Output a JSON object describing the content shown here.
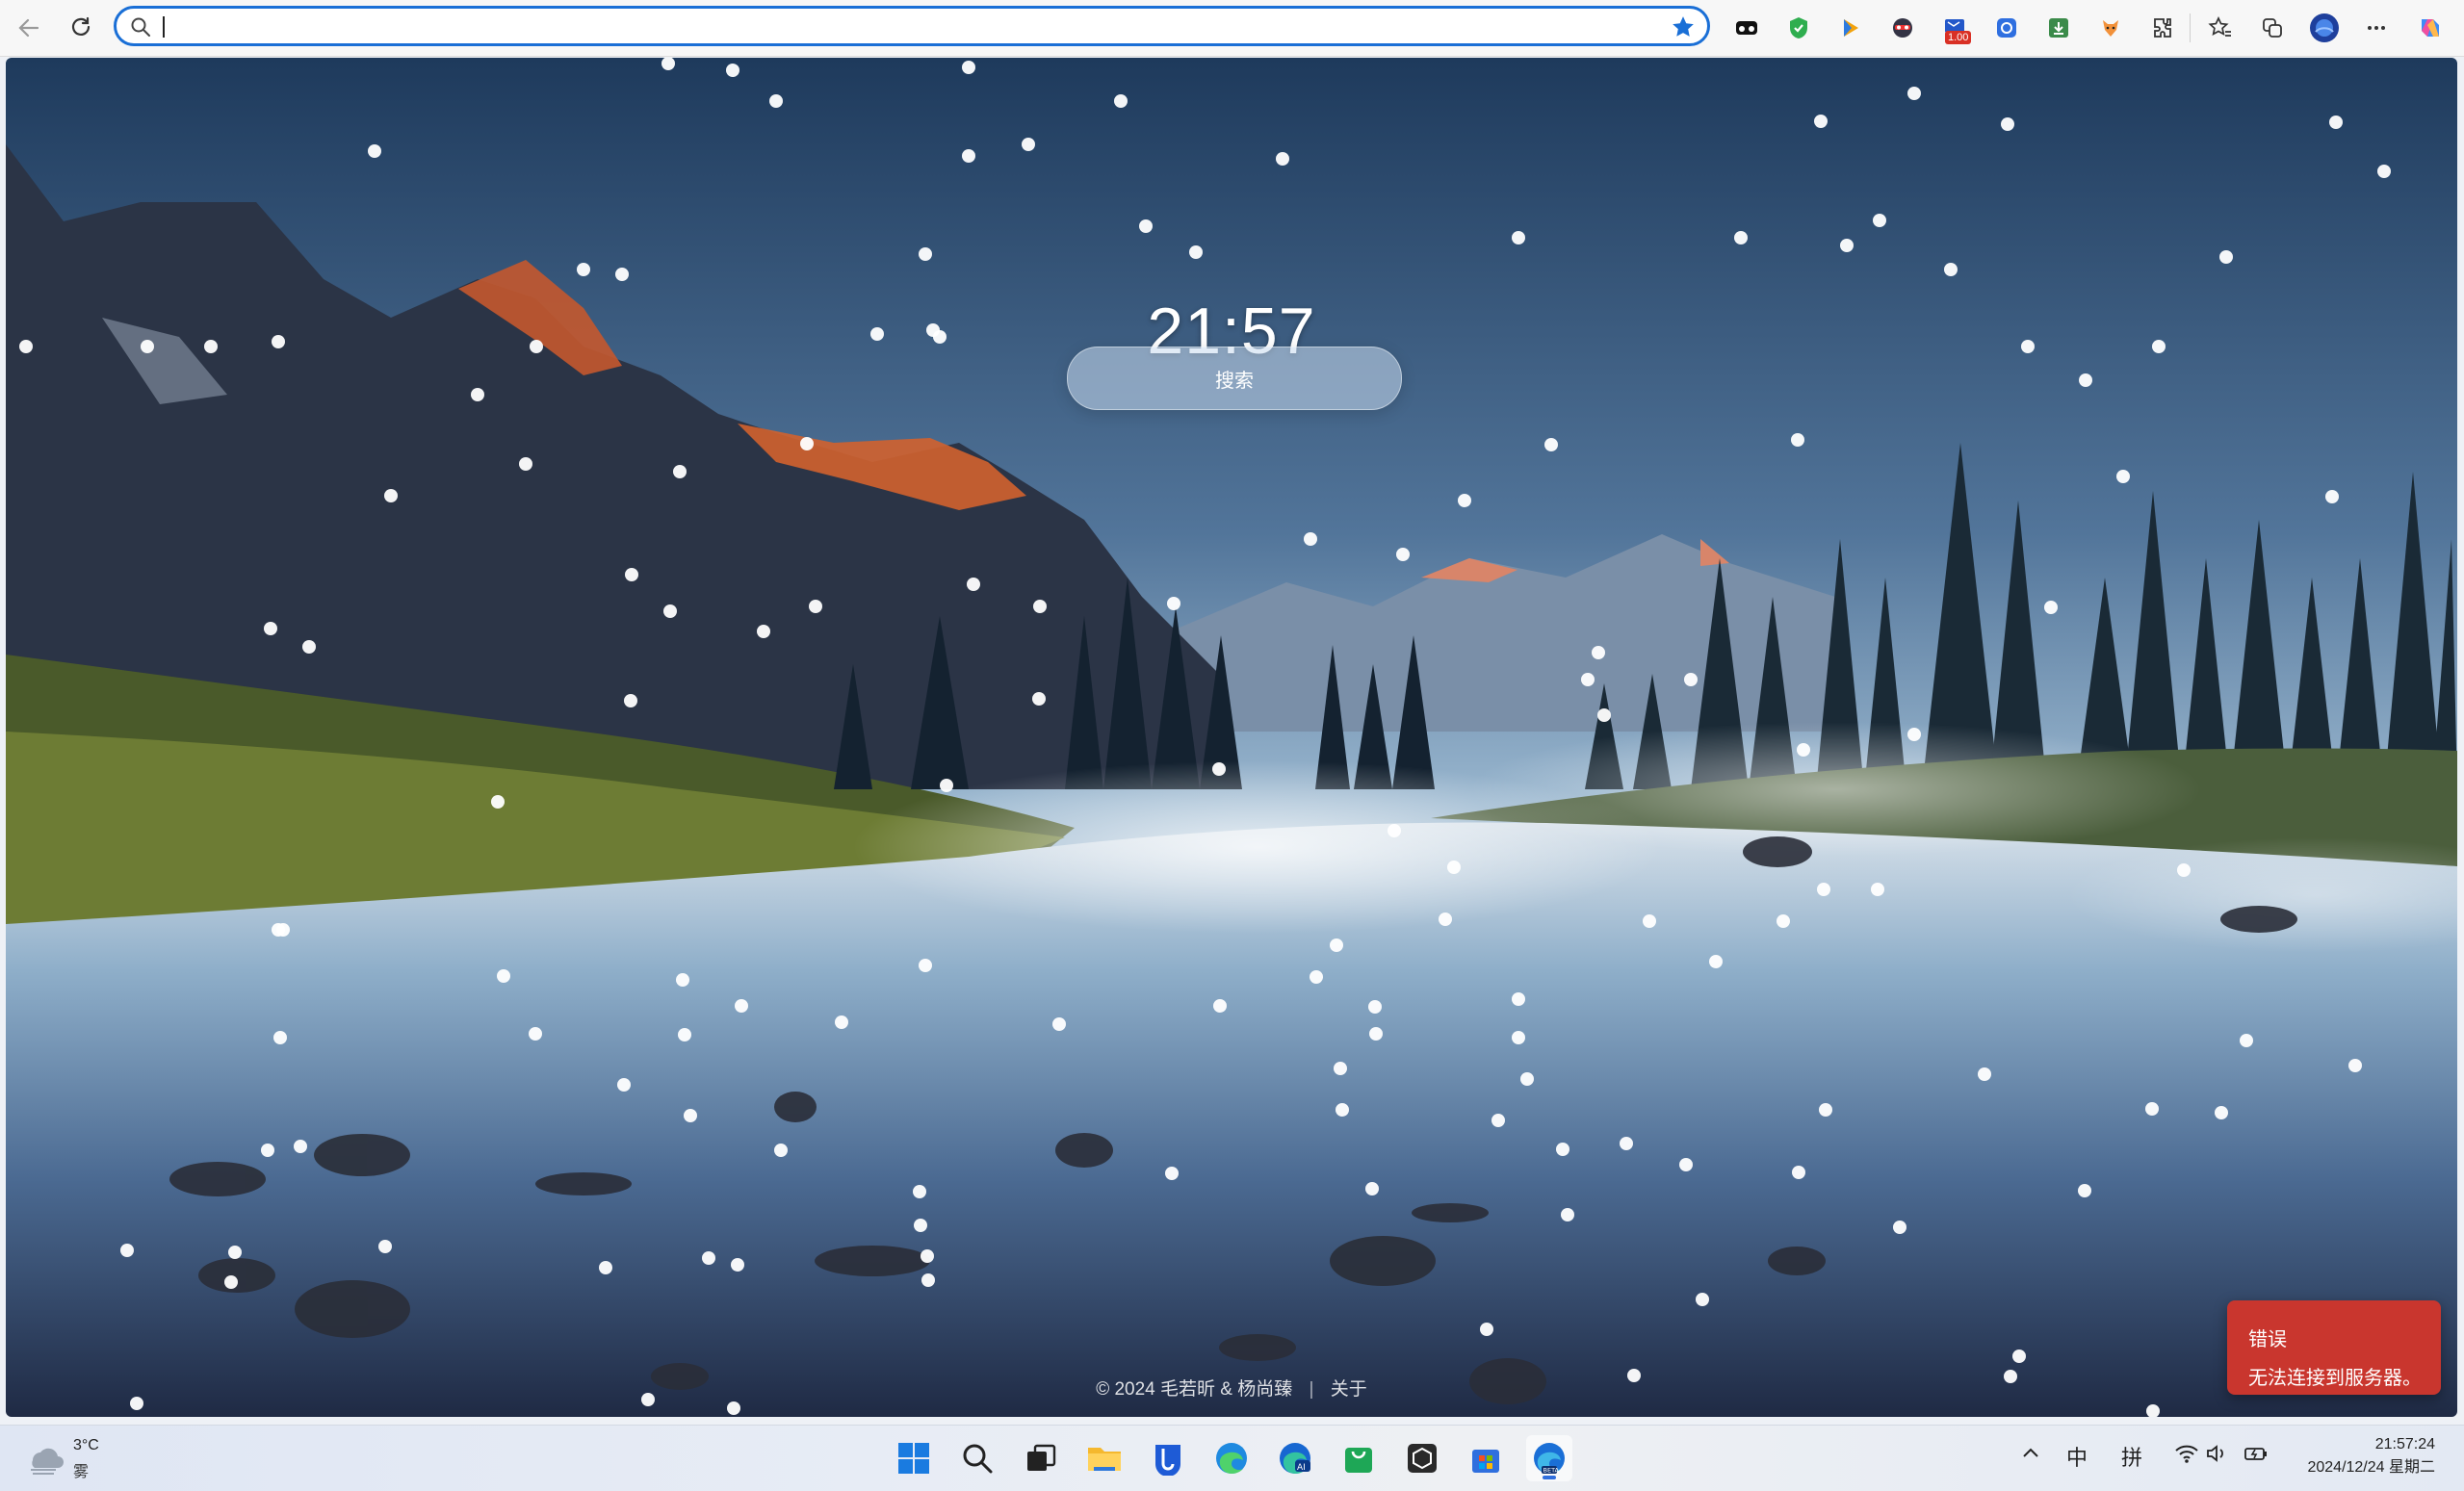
{
  "browser": {
    "address_value": "",
    "address_placeholder": "",
    "extension_badge": "1.00",
    "accent": "#1a6fd6"
  },
  "page": {
    "clock": "21:57",
    "search_label": "搜索",
    "footer_copyright": "© 2024 毛若昕 & 杨尚臻",
    "footer_sep": "|",
    "footer_about": "关于",
    "error_title": "错误",
    "error_message": "无法连接到服务器。",
    "error_color": "#c9362e"
  },
  "taskbar": {
    "weather_temp": "3°C",
    "weather_cond": "雾",
    "ime_lang": "中",
    "ime_mode": "拼",
    "time": "21:57:24",
    "date": "2024/12/24 星期二"
  }
}
